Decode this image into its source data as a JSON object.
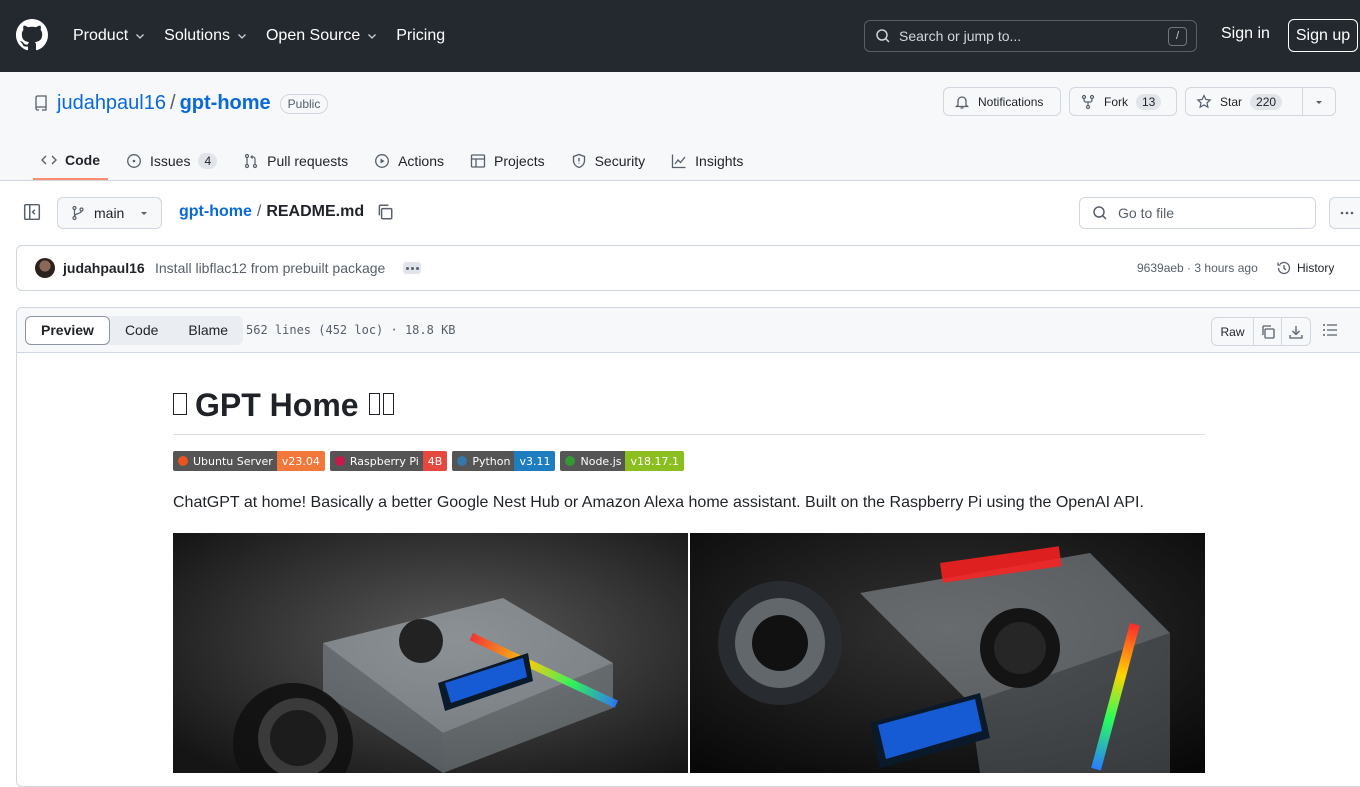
{
  "header": {
    "nav": [
      {
        "label": "Product",
        "dropdown": true
      },
      {
        "label": "Solutions",
        "dropdown": true
      },
      {
        "label": "Open Source",
        "dropdown": true
      },
      {
        "label": "Pricing",
        "dropdown": false
      }
    ],
    "search_placeholder": "Search or jump to...",
    "search_shortcut": "/",
    "sign_in": "Sign in",
    "sign_up": "Sign up"
  },
  "repo": {
    "owner": "judahpaul16",
    "separator": "/",
    "name": "gpt-home",
    "visibility": "Public",
    "notifications_label": "Notifications",
    "fork_label": "Fork",
    "fork_count": "13",
    "star_label": "Star",
    "star_count": "220",
    "tabs": [
      {
        "label": "Code",
        "icon": "code-icon",
        "active": true,
        "count": ""
      },
      {
        "label": "Issues",
        "icon": "issue-icon",
        "active": false,
        "count": "4"
      },
      {
        "label": "Pull requests",
        "icon": "pull-request-icon",
        "active": false,
        "count": ""
      },
      {
        "label": "Actions",
        "icon": "play-icon",
        "active": false,
        "count": ""
      },
      {
        "label": "Projects",
        "icon": "table-icon",
        "active": false,
        "count": ""
      },
      {
        "label": "Security",
        "icon": "shield-icon",
        "active": false,
        "count": ""
      },
      {
        "label": "Insights",
        "icon": "graph-icon",
        "active": false,
        "count": ""
      }
    ]
  },
  "file_nav": {
    "branch": "main",
    "breadcrumb_repo": "gpt-home",
    "breadcrumb_sep": "/",
    "file_name": "README.md",
    "goto_placeholder": "Go to file"
  },
  "commit": {
    "author": "judahpaul16",
    "message": "Install libflac12 from prebuilt package",
    "meta": "9639aeb · 3 hours ago",
    "history_label": "History"
  },
  "file_view": {
    "modes": [
      "Preview",
      "Code",
      "Blame"
    ],
    "active_mode": "Preview",
    "info": "562 lines (452 loc) · 18.8 KB",
    "raw_label": "Raw"
  },
  "readme": {
    "title": "GPT Home",
    "shields": [
      {
        "label": "Ubuntu Server",
        "value": "v23.04",
        "color": "#f1773a",
        "icon_color": "#e95420"
      },
      {
        "label": "Raspberry Pi",
        "value": "4B",
        "color": "#e5483f",
        "icon_color": "#c51a4a"
      },
      {
        "label": "Python",
        "value": "v3.11",
        "color": "#1d7dbf",
        "icon_color": "#3776ab"
      },
      {
        "label": "Node.js",
        "value": "v18.17.1",
        "color": "#8bbf1f",
        "icon_color": "#339933"
      }
    ],
    "description": "ChatGPT at home! Basically a better Google Nest Hub or Amazon Alexa home assistant. Built on the Raspberry Pi using the OpenAI API."
  },
  "colors": {
    "header_bg": "#24292f",
    "link": "#0969da",
    "active_tab_underline": "#fd8c73"
  }
}
